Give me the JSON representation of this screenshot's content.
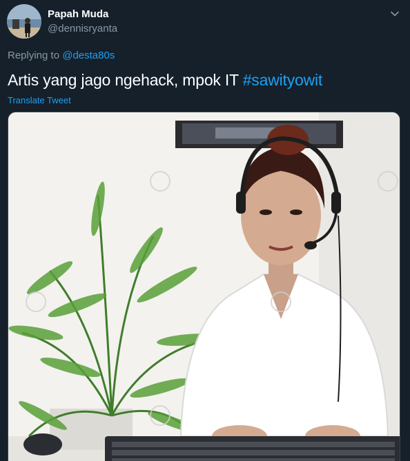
{
  "user": {
    "display_name": "Papah Muda",
    "handle": "@dennisryanta"
  },
  "reply": {
    "prefix": "Replying to ",
    "to": "@desta80s"
  },
  "tweet": {
    "text": "Artis yang jago ngehack, mpok IT ",
    "hashtag": "#sawityowit",
    "translate_label": "Translate Tweet"
  },
  "media": {
    "description_icon": "photo-icon"
  },
  "colors": {
    "background": "#15202b",
    "accent": "#1da1f2",
    "secondary_text": "#8899a6",
    "primary_text": "#ffffff"
  }
}
